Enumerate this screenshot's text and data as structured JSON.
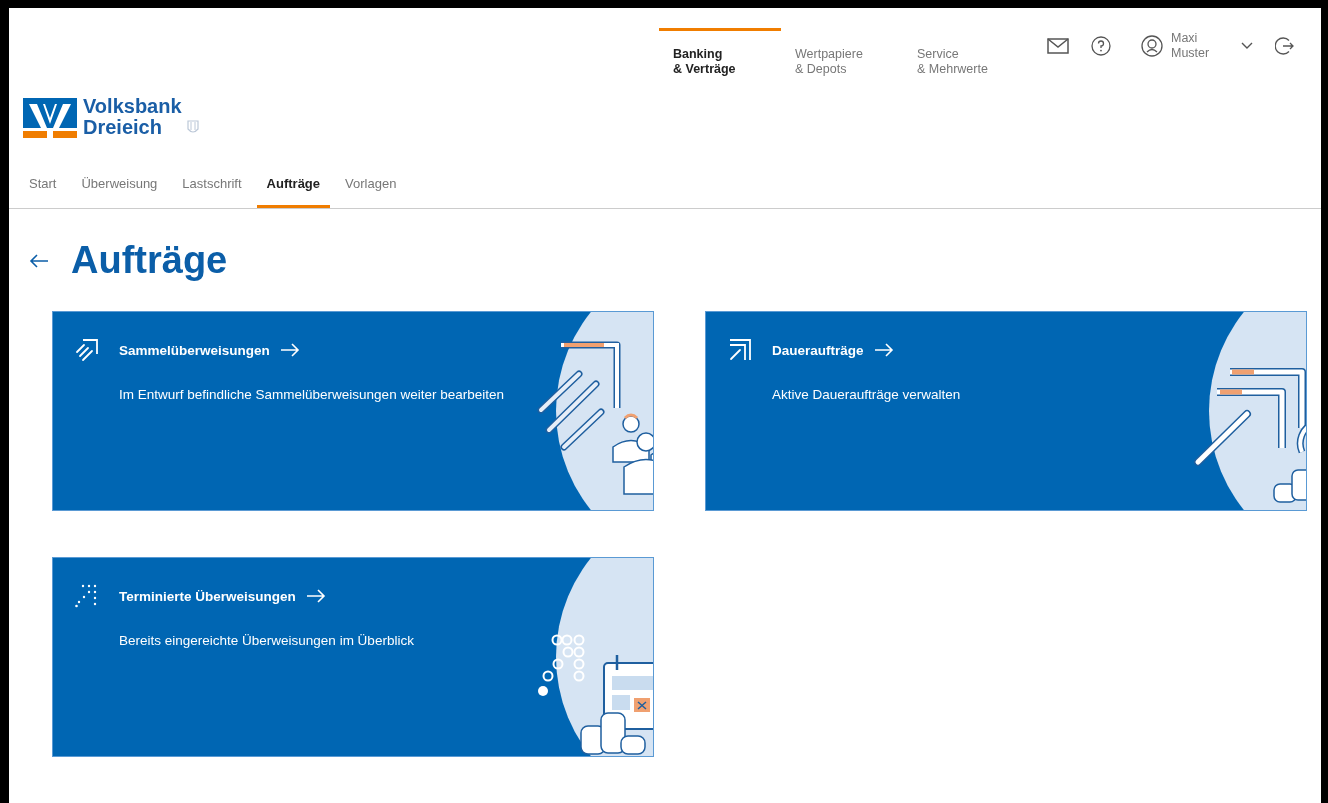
{
  "top_nav": [
    {
      "lines": [
        "Banking",
        "& Verträge"
      ],
      "selected": true
    },
    {
      "lines": [
        "Wertpapiere",
        "& Depots"
      ],
      "selected": false
    },
    {
      "lines": [
        "Service",
        "& Mehrwerte"
      ],
      "selected": false
    }
  ],
  "user": {
    "lines": [
      "Maxi",
      "Muster"
    ]
  },
  "logo": {
    "lines": [
      "Volksbank",
      "Dreieich"
    ]
  },
  "sub_nav": [
    {
      "label": "Start",
      "selected": false
    },
    {
      "label": "Überweisung",
      "selected": false
    },
    {
      "label": "Lastschrift",
      "selected": false
    },
    {
      "label": "Aufträge",
      "selected": true
    },
    {
      "label": "Vorlagen",
      "selected": false
    }
  ],
  "page_title": "Aufträge",
  "cards": [
    {
      "kind": "bulk",
      "title": "Sammelüberweisungen",
      "description": "Im Entwurf befindliche Sammelüberweisungen weiter bearbeiten"
    },
    {
      "kind": "standing",
      "title": "Daueraufträge",
      "description": "Aktive Daueraufträge verwalten"
    },
    {
      "kind": "scheduled",
      "title": "Terminierte Überweisungen",
      "description": "Bereits eingereichte Überweisungen im Überblick"
    }
  ]
}
